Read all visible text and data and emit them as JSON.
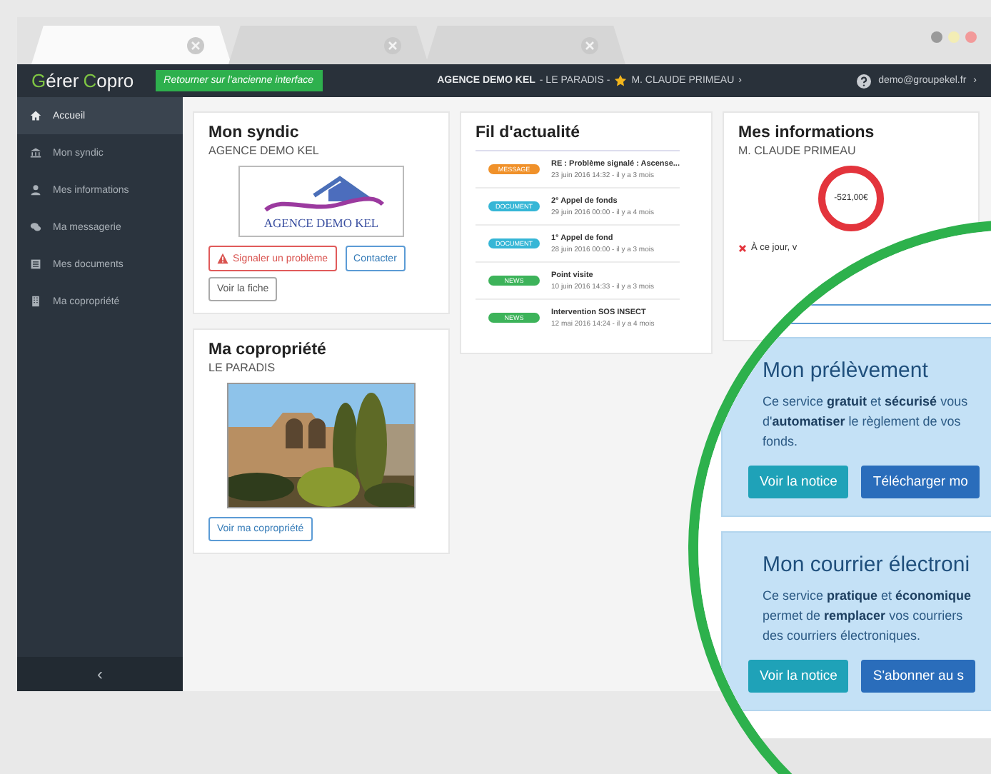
{
  "browser": {
    "tabs": [
      {
        "selected": true
      },
      {
        "selected": false
      },
      {
        "selected": false
      }
    ]
  },
  "navbar": {
    "logo": "Gérer Copro",
    "back_button": "Retourner sur l'ancienne interface",
    "agency": "AGENCE DEMO KEL",
    "residence": " - LE PARADIS - ",
    "owner": "M. CLAUDE PRIMEAU",
    "chevron": "›",
    "user": "demo@groupekel.fr",
    "user_chevron": "›"
  },
  "sidebar": {
    "items": [
      {
        "label": "Accueil",
        "selected": true
      },
      {
        "label": "Mon syndic",
        "selected": false
      },
      {
        "label": "Mes informations",
        "selected": false
      },
      {
        "label": "Ma messagerie",
        "selected": false
      },
      {
        "label": "Mes documents",
        "selected": false
      },
      {
        "label": "Ma copropriété",
        "selected": false
      }
    ],
    "collapse": "‹"
  },
  "syndic": {
    "title": "Mon syndic",
    "name": "AGENCE DEMO KEL",
    "logo_text": "AGENCE DEMO KEL",
    "buttons": [
      {
        "label": "Signaler un problème",
        "kind": "danger"
      },
      {
        "label": "Contacter",
        "kind": "primary"
      },
      {
        "label": "Voir la fiche",
        "kind": "default"
      }
    ]
  },
  "copro": {
    "title": "Ma copropriété",
    "name": "LE PARADIS",
    "button": "Voir ma copropriété"
  },
  "feed": {
    "title": "Fil d'actualité",
    "items": [
      {
        "badge": "MESSAGE",
        "color": "#f0912a",
        "title": "RE : Problème signalé : Ascense...",
        "date": "23 juin 2016 14:32 - il y a 3 mois"
      },
      {
        "badge": "DOCUMENT",
        "color": "#36b6d6",
        "title": "2° Appel de fonds",
        "date": "29 juin 2016 00:00 - il y a 4 mois"
      },
      {
        "badge": "DOCUMENT",
        "color": "#36b6d6",
        "title": "1° Appel de fond",
        "date": "28 juin 2016 00:00 - il y a 3 mois"
      },
      {
        "badge": "NEWS",
        "color": "#3db35a",
        "title": "Point visite",
        "date": "10 juin 2016 14:33 - il y a 3 mois"
      },
      {
        "badge": "NEWS",
        "color": "#3db35a",
        "title": "Intervention SOS INSECT",
        "date": "12 mai 2016 14:24 - il y a 4 mois"
      }
    ]
  },
  "info": {
    "title": "Mes informations",
    "name": "M. CLAUDE PRIMEAU",
    "balance": "-521,00€",
    "notice": "À ce jour, v"
  },
  "zoom": {
    "panels": [
      {
        "title": "Mon prélèvement",
        "lines": [
          "Ce service **gratuit** et **sécurisé** vous",
          "d'**automatiser** le règlement de vos",
          "fonds."
        ],
        "buttons": [
          {
            "label": "Voir la notice",
            "kind": "info"
          },
          {
            "label": "Télécharger mo",
            "kind": "primary"
          }
        ]
      },
      {
        "title": "Mon courrier électroni",
        "lines": [
          "Ce service **pratique** et **économique**",
          "permet de **remplacer** vos courriers",
          "des courriers électroniques."
        ],
        "buttons": [
          {
            "label": "Voir la notice",
            "kind": "info"
          },
          {
            "label": "S'abonner au s",
            "kind": "primary"
          }
        ]
      }
    ]
  }
}
